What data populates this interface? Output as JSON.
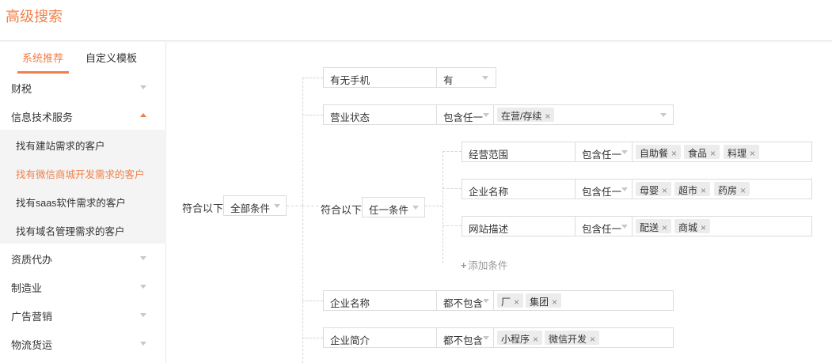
{
  "header": {
    "title": "高级搜索"
  },
  "sidebar": {
    "tabs": [
      {
        "label": "系统推荐",
        "active": true
      },
      {
        "label": "自定义模板",
        "active": false
      }
    ],
    "categories": [
      {
        "label": "财税",
        "expanded": false
      },
      {
        "label": "信息技术服务",
        "expanded": true
      },
      {
        "label": "资质代办",
        "expanded": false
      },
      {
        "label": "制造业",
        "expanded": false
      },
      {
        "label": "广告营销",
        "expanded": false
      },
      {
        "label": "物流货运",
        "expanded": false
      }
    ],
    "sub_items": [
      {
        "label": "找有建站需求的客户",
        "active": false
      },
      {
        "label": "找有微信商城开发需求的客户",
        "active": true
      },
      {
        "label": "找有saas软件需求的客户",
        "active": false
      },
      {
        "label": "找有域名管理需求的客户",
        "active": false
      }
    ]
  },
  "builder": {
    "root": {
      "prefix": "符合以下",
      "match": "全部条件"
    },
    "group": {
      "prefix": "符合以下",
      "match": "任一条件"
    },
    "conditions": [
      {
        "field": "有无手机",
        "op": "有",
        "values": []
      },
      {
        "field": "营业状态",
        "op": "包含任一",
        "values": [
          "在营/存续"
        ]
      },
      {
        "field": "企业名称",
        "op": "都不包含",
        "values": [
          "厂",
          "集团"
        ]
      },
      {
        "field": "企业简介",
        "op": "都不包含",
        "values": [
          "小程序",
          "微信开发"
        ]
      }
    ],
    "group_conditions": [
      {
        "field": "经营范围",
        "op": "包含任一",
        "values": [
          "自助餐",
          "食品",
          "料理"
        ]
      },
      {
        "field": "企业名称",
        "op": "包含任一",
        "values": [
          "母婴",
          "超市",
          "药房"
        ]
      },
      {
        "field": "网站描述",
        "op": "包含任一",
        "values": [
          "配送",
          "商城"
        ]
      }
    ],
    "add_condition_label": "添加条件",
    "remove_symbol": "×"
  },
  "colors": {
    "accent": "#f0804a",
    "border": "#dcdcdc",
    "tag_bg": "#ececec"
  }
}
